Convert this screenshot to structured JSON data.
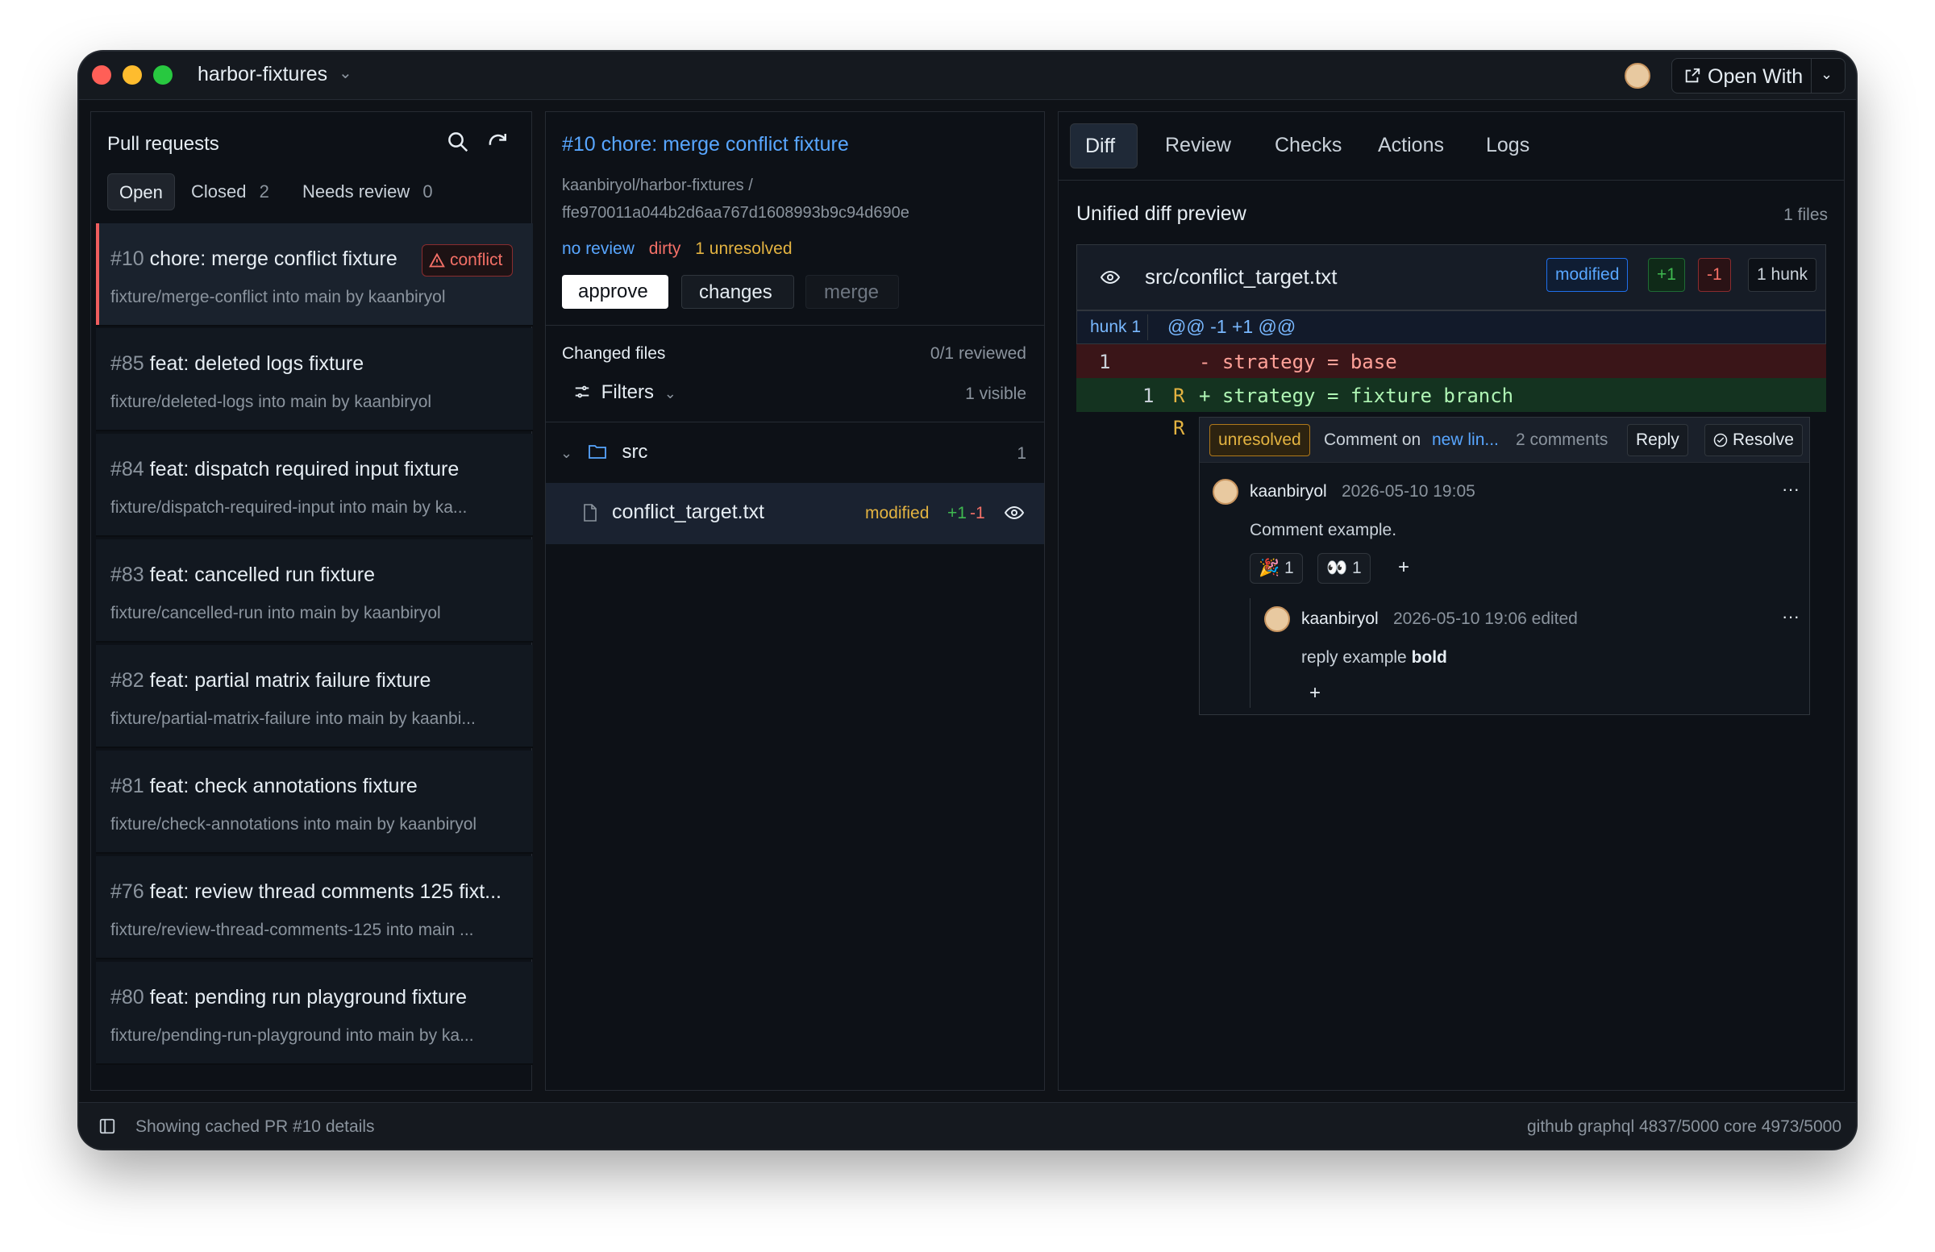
{
  "titlebar": {
    "repo": "harbor-fixtures",
    "open_with_label": "Open With"
  },
  "left": {
    "title": "Pull requests",
    "tabs": [
      {
        "label": "Open",
        "count": ""
      },
      {
        "label": "Closed",
        "count": "2"
      },
      {
        "label": "Needs review",
        "count": "0"
      }
    ],
    "items": [
      {
        "num": "#10",
        "title": "chore: merge conflict fixture",
        "branch": "fixture/merge-conflict into main by kaanbiryol",
        "badge": "conflict"
      },
      {
        "num": "#85",
        "title": "feat: deleted logs fixture",
        "branch": "fixture/deleted-logs into main by kaanbiryol"
      },
      {
        "num": "#84",
        "title": "feat: dispatch required input fixture",
        "branch": "fixture/dispatch-required-input into main by ka..."
      },
      {
        "num": "#83",
        "title": "feat: cancelled run fixture",
        "branch": "fixture/cancelled-run into main by kaanbiryol"
      },
      {
        "num": "#82",
        "title": "feat: partial matrix failure fixture",
        "branch": "fixture/partial-matrix-failure into main by kaanbi..."
      },
      {
        "num": "#81",
        "title": "feat: check annotations fixture",
        "branch": "fixture/check-annotations into main by kaanbiryol"
      },
      {
        "num": "#76",
        "title": "feat: review thread comments 125 fixt...",
        "branch": "fixture/review-thread-comments-125 into main ..."
      },
      {
        "num": "#80",
        "title": "feat: pending run playground fixture",
        "branch": "fixture/pending-run-playground into main by ka..."
      }
    ]
  },
  "mid": {
    "title": "#10 chore: merge conflict fixture",
    "path_line1": "kaanbiryol/harbor-fixtures /",
    "path_line2": "ffe970011a044b2d6aa767d1608993b9c94d690e",
    "status": {
      "review": "no review",
      "state": "dirty",
      "unresolved": "1 unresolved"
    },
    "actions": {
      "approve": "approve",
      "changes": "changes",
      "merge": "merge"
    },
    "changed_files_label": "Changed files",
    "reviewed_count": "0/1 reviewed",
    "filters_label": "Filters",
    "visible_count": "1 visible",
    "folder": {
      "name": "src",
      "count": "1"
    },
    "file": {
      "name": "conflict_target.txt",
      "status": "modified",
      "added": "+1",
      "removed": "-1"
    }
  },
  "right": {
    "tabs": [
      "Diff",
      "Review",
      "Checks",
      "Actions",
      "Logs"
    ],
    "section_title": "Unified diff preview",
    "files_count": "1 files",
    "file_path": "src/conflict_target.txt",
    "file_status": "modified",
    "added": "+1",
    "removed": "-1",
    "hunks": "1 hunk",
    "hunk_label": "hunk 1",
    "hunk_header": "@@ -1 +1 @@",
    "del_line": {
      "old_no": "1",
      "text": "- strategy = base"
    },
    "add_line": {
      "new_no": "1",
      "marker": "R",
      "text": "+ strategy = fixture branch"
    },
    "thread_marker": "R",
    "thread": {
      "status": "unresolved",
      "comment_on": "Comment on",
      "location": "new lin...",
      "count": "2 comments",
      "reply": "Reply",
      "resolve": "Resolve",
      "comments": [
        {
          "author": "kaanbiryol",
          "time": "2026-05-10 19:05",
          "body": "Comment example.",
          "reactions": [
            {
              "emoji": "🎉",
              "count": "1"
            },
            {
              "emoji": "👀",
              "count": "1"
            }
          ]
        },
        {
          "author": "kaanbiryol",
          "time": "2026-05-10 19:06 edited",
          "body_plain": "reply example ",
          "body_bold": "bold"
        }
      ]
    }
  },
  "statusbar": {
    "message": "Showing cached PR #10 details",
    "rate": "github graphql 4837/5000 core 4973/5000"
  },
  "colors": {
    "accent_blue": "#58a6ff",
    "conflict_red": "#f47067",
    "add_green": "#3fb950",
    "warn_yellow": "#e3b341"
  }
}
